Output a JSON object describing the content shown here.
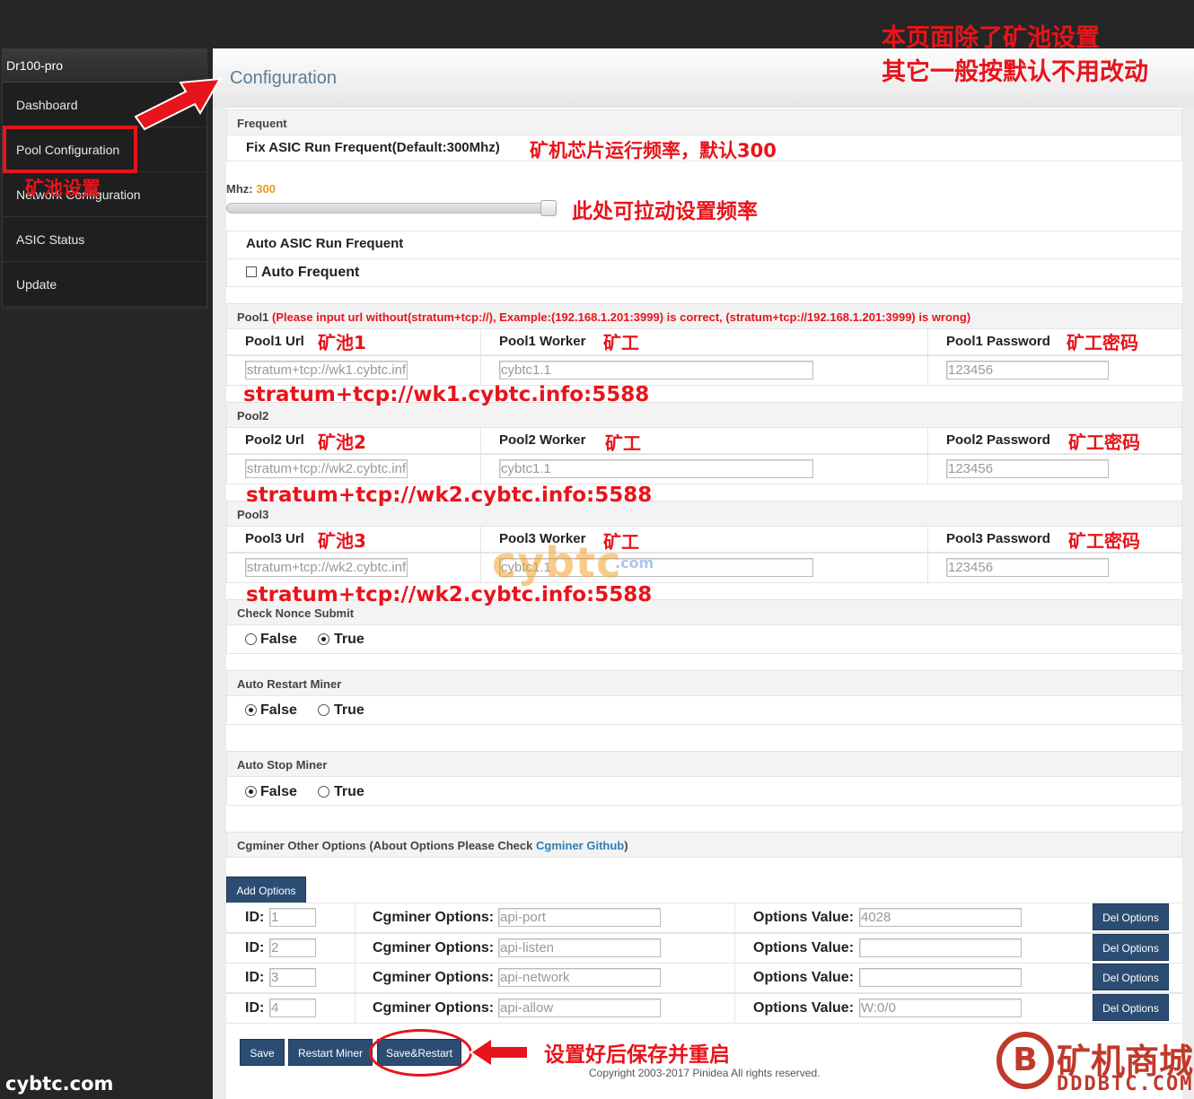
{
  "sidebar": {
    "brand": "Dr100-pro",
    "items": [
      {
        "label": "Dashboard"
      },
      {
        "label": "Pool Configuration"
      },
      {
        "label": "Network Configuration"
      },
      {
        "label": "ASIC Status"
      },
      {
        "label": "Update"
      }
    ]
  },
  "header": {
    "title": "Configuration"
  },
  "frequent": {
    "section": "Frequent",
    "fix_label": "Fix ASIC Run Frequent(Default:300Mhz)",
    "mhz_label": "Mhz:",
    "mhz_value": "300",
    "slider_fraction": 1.0,
    "auto_label": "Auto ASIC Run Frequent",
    "auto_checkbox_label": "Auto Frequent"
  },
  "pools": [
    {
      "section": "Pool1",
      "note": "(Please input url without(stratum+tcp://), Example:(192.168.1.201:3999) is correct, (stratum+tcp://192.168.1.201:3999) is wrong)",
      "url_label": "Pool1 Url",
      "worker_label": "Pool1 Worker",
      "password_label": "Pool1 Password",
      "url_value": "stratum+tcp://wk1.cybtc.info:5588",
      "worker_value": "cybtc1.1",
      "password_value": "123456"
    },
    {
      "section": "Pool2",
      "note": "",
      "url_label": "Pool2 Url",
      "worker_label": "Pool2 Worker",
      "password_label": "Pool2 Password",
      "url_value": "stratum+tcp://wk2.cybtc.info:5588",
      "worker_value": "cybtc1.1",
      "password_value": "123456"
    },
    {
      "section": "Pool3",
      "note": "",
      "url_label": "Pool3 Url",
      "worker_label": "Pool3 Worker",
      "password_label": "Pool3 Password",
      "url_value": "stratum+tcp://wk2.cybtc.info:5588",
      "worker_value": "cybtc1.1",
      "password_value": "123456"
    }
  ],
  "check_nonce": {
    "section": "Check Nonce Submit",
    "false_label": "False",
    "true_label": "True",
    "selected": "True"
  },
  "auto_restart": {
    "section": "Auto Restart Miner",
    "false_label": "False",
    "true_label": "True",
    "selected": "False"
  },
  "auto_stop": {
    "section": "Auto Stop Miner",
    "false_label": "False",
    "true_label": "True",
    "selected": "False"
  },
  "cgminer": {
    "section_prefix": "Cgminer Other Options (About Options Please Check ",
    "section_link": "Cgminer Github",
    "section_suffix": ")",
    "add_button": "Add Options",
    "id_label": "ID:",
    "option_label": "Cgminer Options:",
    "value_label": "Options Value:",
    "del_button": "Del Options",
    "rows": [
      {
        "id": "1",
        "option": "api-port",
        "value": "4028"
      },
      {
        "id": "2",
        "option": "api-listen",
        "value": ""
      },
      {
        "id": "3",
        "option": "api-network",
        "value": ""
      },
      {
        "id": "4",
        "option": "api-allow",
        "value": "W:0/0"
      }
    ]
  },
  "footer": {
    "save": "Save",
    "restart": "Restart Miner",
    "save_restart": "Save&Restart",
    "copyright": "Copyright 2003-2017 Pinidea All rights reserved."
  },
  "annotations": {
    "top_line1": "本页面除了矿池设置",
    "top_line2": "其它一般按默认不用改动",
    "pool_config": "矿池设置",
    "freq": "矿机芯片运行频率，默认300",
    "slider": "此处可拉动设置频率",
    "pool1": "矿池1",
    "pool2": "矿池2",
    "pool3": "矿池3",
    "worker": "矿工",
    "password": "矿工密码",
    "url1": "stratum+tcp://wk1.cybtc.info:5588",
    "url2": "stratum+tcp://wk2.cybtc.info:5588",
    "url3": "stratum+tcp://wk2.cybtc.info:5588",
    "save_hint": "设置好后保存并重启"
  },
  "watermarks": {
    "left": "cybtc.com",
    "mid": "cybtc",
    "mid_small": ".com",
    "right_logo": "B",
    "right_cn": "矿机商城",
    "right_en": "DDDBTC.COM"
  },
  "colors": {
    "accent": "#2c4d73",
    "annotation": "#e8141b",
    "title": "#5b7c94",
    "mhz": "#e69a1e"
  }
}
